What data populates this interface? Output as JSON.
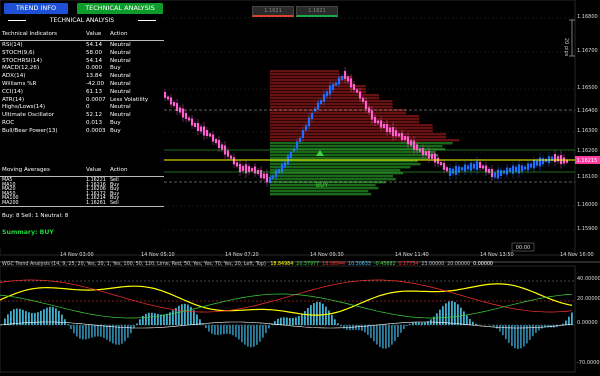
{
  "buttons": {
    "trend_info": "TREND INFO",
    "technical_analysis": "TECHNICAL ANALYSIS"
  },
  "price_buttons": {
    "sell": "1.1621",
    "buy": "1.1621"
  },
  "panel": {
    "title": "TECHNICAL ANALYSIS",
    "header": {
      "name": "Technical Indicators",
      "value": "Value",
      "action": "Action"
    },
    "indicators": [
      {
        "name": "RSI(14)",
        "value": "54.14",
        "action": "Neutral"
      },
      {
        "name": "STOCH(9,6)",
        "value": "58.00",
        "action": "Neutral"
      },
      {
        "name": "STOCHRSI(14)",
        "value": "54.14",
        "action": "Neutral"
      },
      {
        "name": "MACD(12,26)",
        "value": "0.000",
        "action": "Buy"
      },
      {
        "name": "ADX(14)",
        "value": "13.84",
        "action": "Neutral"
      },
      {
        "name": "Williams %R",
        "value": "-42.00",
        "action": "Neutral"
      },
      {
        "name": "CCI(14)",
        "value": "61.13",
        "action": "Neutral"
      },
      {
        "name": "ATR(14)",
        "value": "0.0007",
        "action": "Less Volatility"
      },
      {
        "name": "Highs/Lows(14)",
        "value": "0",
        "action": "Neutral"
      },
      {
        "name": "Ultimate Oscillator",
        "value": "52.12",
        "action": "Neutral"
      },
      {
        "name": "ROC",
        "value": "0.013",
        "action": "Buy"
      },
      {
        "name": "Bull/Bear Power(13)",
        "value": "0.0003",
        "action": "Buy"
      }
    ],
    "ma_header": {
      "name": "Moving Averages",
      "value": "Value",
      "action": "Action"
    },
    "mas": [
      {
        "name": "MA5",
        "value": "1.16221",
        "action": "Sell"
      },
      {
        "name": "MA10",
        "value": "1.16216",
        "action": "Buy"
      },
      {
        "name": "MA20",
        "value": "1.16206",
        "action": "Buy"
      },
      {
        "name": "MA50",
        "value": "1.16172",
        "action": "Buy"
      },
      {
        "name": "MA100",
        "value": "1.16214",
        "action": "Buy"
      },
      {
        "name": "MA200",
        "value": "1.16261",
        "action": "Sell"
      }
    ],
    "tally": "Buy: 8    Sell: 1    Neutral: 8",
    "summary": "Summary: BUY"
  },
  "chart": {
    "buy_label": "BUY",
    "current_price": "1.16215",
    "pips_label": "20 pips",
    "timer": "00:00",
    "price_ticks": [
      "1.16800",
      "1.16700",
      "1.16500",
      "1.16400",
      "1.16300",
      "1.16200",
      "1.16100",
      "1.16000",
      "1.15900"
    ],
    "time_ticks": [
      "14 Nov 03:00",
      "14 Nov 05:10",
      "14 Nov 07:20",
      "14 Nov 09:30",
      "14 Nov 11:40",
      "14 Nov 13:50",
      "14 Nov 16:00"
    ]
  },
  "indicator": {
    "caption": "WGC Trend Analysis (14, 9, 25, 20, Yes, 20, 1, Yes, 100, 50, 120, Lime, Red, 50, Yes, Yes, 70, Yes, 20, Left, Top)",
    "values": [
      "18.84984",
      "20.37977",
      "18.08944",
      "10.30633",
      "-0.45682",
      "0.17754",
      "23.00000",
      "20.00000",
      "0.00000"
    ],
    "value_colors": [
      "#ffff00",
      "#3fd23f",
      "#ff3030",
      "#3fc0ff",
      "#3fd23f",
      "#ff3030",
      "#bbbbbb",
      "#bbbbbb",
      "#ffffff"
    ],
    "ticks": [
      "40.00000",
      "20.00000",
      "0.00000",
      "-70.00000"
    ]
  },
  "colors": {
    "bull": "#1e6eff",
    "bear": "#ff5fd0",
    "price_line": "#ffff00",
    "trend": "#3fd23f"
  }
}
